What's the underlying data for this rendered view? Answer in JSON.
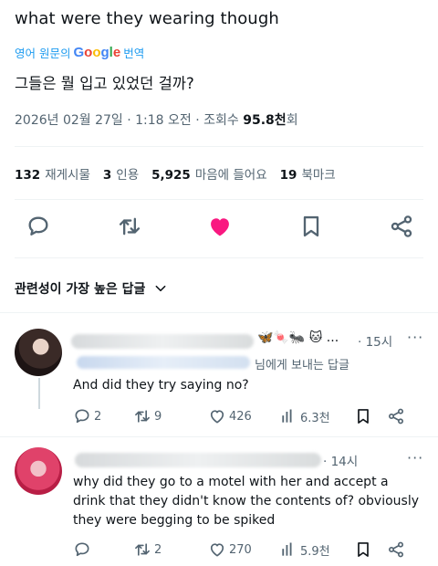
{
  "tweet": {
    "text": "what were they wearing though",
    "translate_prefix": "영어 원문의",
    "translate_google": "Google",
    "translate_suffix": "번역",
    "translated_text": "그들은 뭘 입고 있었던 걸까?",
    "date": "2026년 02월 27일 · 1:18 오전 · 조회수 ",
    "views": "95.8천",
    "views_suffix": "회"
  },
  "stats": [
    {
      "count": "132",
      "label": "재게시물"
    },
    {
      "count": "3",
      "label": "인용"
    },
    {
      "count": "5,925",
      "label": "마음에 들어요"
    },
    {
      "count": "19",
      "label": "북마크"
    }
  ],
  "actions": [
    "reply-icon",
    "retweet-icon",
    "like-icon-filled",
    "bookmark-icon",
    "share-icon"
  ],
  "colors": {
    "like": "#f91880",
    "link": "#1d9bf0",
    "secondary": "#536471"
  },
  "sort": {
    "label": "관련성이 가장 높은 답글"
  },
  "replies": [
    {
      "time": "· 15시",
      "more": "···",
      "reply_to_suffix": "님에게 보내는 답글",
      "text": "And did they try saying no?",
      "reply_count": "2",
      "retweet_count": "9",
      "like_count": "426",
      "views": "6.3천"
    },
    {
      "time": "· 14시",
      "more": "···",
      "text": "why did they go to a motel with her and accept a drink that they didn't know the contents of? obviously they were begging to be spiked",
      "reply_count": "",
      "retweet_count": "2",
      "like_count": "270",
      "views": "5.9천"
    }
  ]
}
